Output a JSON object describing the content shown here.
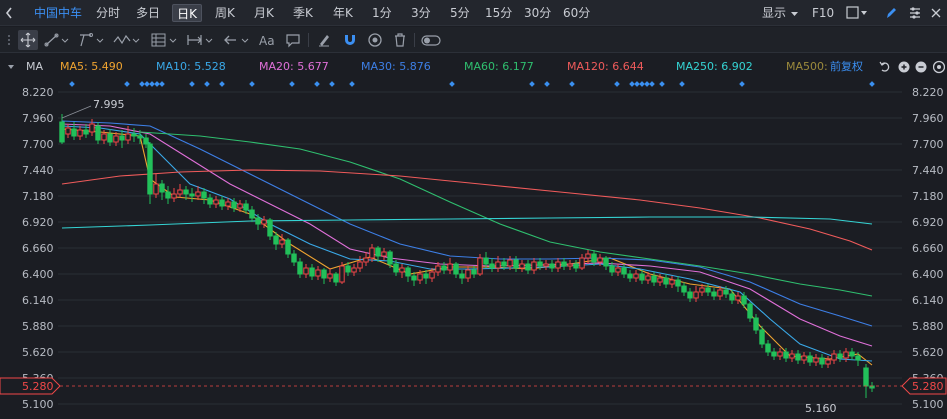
{
  "tabs": {
    "stock": "中国中车",
    "items": [
      "分时",
      "多日",
      "日K",
      "周K",
      "月K",
      "季K",
      "年K",
      "1分",
      "3分",
      "5分",
      "15分",
      "30分",
      "60分"
    ],
    "selected": "日K",
    "display_label": "显示",
    "f10_label": "F10"
  },
  "ma_bar": {
    "label": "MA",
    "items": [
      {
        "name": "MA5",
        "value": "5.490",
        "color": "#f0a430"
      },
      {
        "name": "MA10",
        "value": "5.528",
        "color": "#3aa9e8"
      },
      {
        "name": "MA20",
        "value": "5.677",
        "color": "#e070d9"
      },
      {
        "name": "MA30",
        "value": "5.876",
        "color": "#3d7fe6"
      },
      {
        "name": "MA60",
        "value": "6.177",
        "color": "#2fbf6f"
      },
      {
        "name": "MA120",
        "value": "6.644",
        "color": "#f05b5b"
      },
      {
        "name": "MA250",
        "value": "6.902",
        "color": "#35d4d4"
      },
      {
        "name": "MA500",
        "value": "",
        "color": "#9c8a3c"
      }
    ],
    "adjust_label": "前复权"
  },
  "colors": {
    "up": "#f04848",
    "down": "#22c05a",
    "grid": "#2a2e36",
    "axis_text": "#b8bcc4",
    "marker": "#3a8ff0",
    "price_tag": "#f04848"
  },
  "chart_data": {
    "type": "candlestick",
    "y_ticks": [
      "8.220",
      "7.960",
      "7.700",
      "7.440",
      "7.180",
      "6.920",
      "6.660",
      "6.400",
      "6.140",
      "5.880",
      "5.620",
      "5.360",
      "5.100"
    ],
    "ylim": [
      5.1,
      8.22
    ],
    "current_price": "5.280",
    "high_label": "7.995",
    "low_label": "5.160",
    "marker_positions": [
      72,
      127,
      142,
      147,
      152,
      157,
      162,
      192,
      207,
      222,
      252,
      292,
      317,
      332,
      352,
      452,
      532,
      547,
      572,
      617,
      632,
      637,
      642,
      647,
      652,
      662,
      682,
      742,
      872
    ],
    "ma_lines": {
      "MA5": [
        [
          62,
          7.85
        ],
        [
          100,
          7.82
        ],
        [
          140,
          7.78
        ],
        [
          150,
          7.35
        ],
        [
          175,
          7.17
        ],
        [
          210,
          7.14
        ],
        [
          250,
          7.0
        ],
        [
          290,
          6.7
        ],
        [
          330,
          6.45
        ],
        [
          370,
          6.57
        ],
        [
          410,
          6.4
        ],
        [
          450,
          6.47
        ],
        [
          490,
          6.47
        ],
        [
          530,
          6.45
        ],
        [
          570,
          6.5
        ],
        [
          610,
          6.56
        ],
        [
          650,
          6.4
        ],
        [
          690,
          6.3
        ],
        [
          730,
          6.25
        ],
        [
          760,
          5.88
        ],
        [
          790,
          5.58
        ],
        [
          830,
          5.55
        ],
        [
          858,
          5.6
        ],
        [
          872,
          5.49
        ]
      ],
      "MA10": [
        [
          62,
          7.88
        ],
        [
          100,
          7.86
        ],
        [
          140,
          7.8
        ],
        [
          160,
          7.6
        ],
        [
          190,
          7.3
        ],
        [
          230,
          7.15
        ],
        [
          270,
          6.9
        ],
        [
          310,
          6.7
        ],
        [
          350,
          6.55
        ],
        [
          390,
          6.53
        ],
        [
          430,
          6.45
        ],
        [
          470,
          6.45
        ],
        [
          510,
          6.46
        ],
        [
          550,
          6.47
        ],
        [
          600,
          6.5
        ],
        [
          640,
          6.45
        ],
        [
          690,
          6.35
        ],
        [
          740,
          6.22
        ],
        [
          770,
          5.95
        ],
        [
          800,
          5.7
        ],
        [
          840,
          5.55
        ],
        [
          872,
          5.53
        ]
      ],
      "MA20": [
        [
          62,
          7.9
        ],
        [
          110,
          7.88
        ],
        [
          150,
          7.8
        ],
        [
          190,
          7.55
        ],
        [
          230,
          7.3
        ],
        [
          270,
          7.1
        ],
        [
          310,
          6.9
        ],
        [
          350,
          6.65
        ],
        [
          390,
          6.56
        ],
        [
          440,
          6.5
        ],
        [
          490,
          6.48
        ],
        [
          540,
          6.49
        ],
        [
          600,
          6.51
        ],
        [
          650,
          6.48
        ],
        [
          700,
          6.42
        ],
        [
          750,
          6.25
        ],
        [
          800,
          5.95
        ],
        [
          840,
          5.78
        ],
        [
          872,
          5.68
        ]
      ],
      "MA30": [
        [
          62,
          7.93
        ],
        [
          110,
          7.91
        ],
        [
          150,
          7.88
        ],
        [
          200,
          7.65
        ],
        [
          250,
          7.4
        ],
        [
          300,
          7.15
        ],
        [
          350,
          6.9
        ],
        [
          400,
          6.7
        ],
        [
          450,
          6.58
        ],
        [
          500,
          6.55
        ],
        [
          550,
          6.55
        ],
        [
          600,
          6.56
        ],
        [
          650,
          6.54
        ],
        [
          700,
          6.47
        ],
        [
          750,
          6.32
        ],
        [
          800,
          6.1
        ],
        [
          840,
          5.98
        ],
        [
          872,
          5.88
        ]
      ],
      "MA60": [
        [
          140,
          7.82
        ],
        [
          200,
          7.78
        ],
        [
          250,
          7.72
        ],
        [
          300,
          7.65
        ],
        [
          350,
          7.52
        ],
        [
          400,
          7.35
        ],
        [
          450,
          7.12
        ],
        [
          500,
          6.9
        ],
        [
          550,
          6.72
        ],
        [
          600,
          6.62
        ],
        [
          650,
          6.55
        ],
        [
          700,
          6.48
        ],
        [
          750,
          6.4
        ],
        [
          800,
          6.3
        ],
        [
          840,
          6.24
        ],
        [
          872,
          6.18
        ]
      ],
      "MA120": [
        [
          62,
          7.3
        ],
        [
          120,
          7.38
        ],
        [
          180,
          7.42
        ],
        [
          250,
          7.44
        ],
        [
          320,
          7.43
        ],
        [
          400,
          7.38
        ],
        [
          480,
          7.3
        ],
        [
          560,
          7.22
        ],
        [
          640,
          7.14
        ],
        [
          700,
          7.06
        ],
        [
          760,
          6.96
        ],
        [
          810,
          6.85
        ],
        [
          850,
          6.73
        ],
        [
          872,
          6.64
        ]
      ],
      "MA250": [
        [
          62,
          6.86
        ],
        [
          150,
          6.89
        ],
        [
          250,
          6.93
        ],
        [
          350,
          6.94
        ],
        [
          450,
          6.95
        ],
        [
          550,
          6.96
        ],
        [
          650,
          6.97
        ],
        [
          750,
          6.97
        ],
        [
          830,
          6.95
        ],
        [
          872,
          6.9
        ]
      ]
    },
    "candles": [
      [
        62,
        7.92,
        7.72,
        8.0,
        7.7
      ],
      [
        68,
        7.8,
        7.86,
        7.9,
        7.76
      ],
      [
        74,
        7.85,
        7.78,
        7.92,
        7.74
      ],
      [
        80,
        7.78,
        7.84,
        7.88,
        7.74
      ],
      [
        86,
        7.84,
        7.8,
        7.9,
        7.76
      ],
      [
        92,
        7.82,
        7.9,
        7.95,
        7.78
      ],
      [
        98,
        7.88,
        7.74,
        7.92,
        7.7
      ],
      [
        104,
        7.74,
        7.8,
        7.84,
        7.7
      ],
      [
        110,
        7.8,
        7.72,
        7.85,
        7.68
      ],
      [
        116,
        7.72,
        7.78,
        7.82,
        7.68
      ],
      [
        122,
        7.78,
        7.74,
        7.84,
        7.66
      ],
      [
        128,
        7.74,
        7.8,
        7.88,
        7.7
      ],
      [
        134,
        7.8,
        7.78,
        7.86,
        7.72
      ],
      [
        140,
        7.78,
        7.76,
        7.84,
        7.7
      ],
      [
        146,
        7.76,
        7.7,
        7.8,
        7.66
      ],
      [
        150,
        7.7,
        7.2,
        7.72,
        7.1
      ],
      [
        156,
        7.2,
        7.3,
        7.4,
        7.16
      ],
      [
        162,
        7.3,
        7.22,
        7.34,
        7.14
      ],
      [
        168,
        7.22,
        7.16,
        7.28,
        7.1
      ],
      [
        174,
        7.16,
        7.2,
        7.26,
        7.12
      ],
      [
        180,
        7.2,
        7.24,
        7.3,
        7.16
      ],
      [
        186,
        7.24,
        7.2,
        7.28,
        7.14
      ],
      [
        192,
        7.2,
        7.18,
        7.26,
        7.12
      ],
      [
        198,
        7.18,
        7.22,
        7.28,
        7.14
      ],
      [
        204,
        7.22,
        7.16,
        7.26,
        7.1
      ],
      [
        210,
        7.16,
        7.1,
        7.2,
        7.06
      ],
      [
        216,
        7.1,
        7.14,
        7.18,
        7.06
      ],
      [
        222,
        7.14,
        7.08,
        7.18,
        7.04
      ],
      [
        228,
        7.08,
        7.12,
        7.16,
        7.04
      ],
      [
        234,
        7.12,
        7.06,
        7.16,
        7.02
      ],
      [
        240,
        7.06,
        7.1,
        7.14,
        7.02
      ],
      [
        246,
        7.1,
        7.04,
        7.14,
        7.0
      ],
      [
        252,
        7.04,
        6.96,
        7.08,
        6.92
      ],
      [
        258,
        6.96,
        6.9,
        7.0,
        6.84
      ],
      [
        264,
        6.9,
        6.94,
        6.98,
        6.86
      ],
      [
        270,
        6.94,
        6.78,
        6.96,
        6.74
      ],
      [
        276,
        6.78,
        6.7,
        6.82,
        6.64
      ],
      [
        282,
        6.7,
        6.74,
        6.8,
        6.66
      ],
      [
        288,
        6.74,
        6.6,
        6.76,
        6.56
      ],
      [
        294,
        6.6,
        6.52,
        6.64,
        6.48
      ],
      [
        300,
        6.52,
        6.4,
        6.56,
        6.36
      ],
      [
        306,
        6.4,
        6.46,
        6.5,
        6.36
      ],
      [
        312,
        6.46,
        6.38,
        6.5,
        6.34
      ],
      [
        318,
        6.38,
        6.44,
        6.48,
        6.34
      ],
      [
        324,
        6.44,
        6.36,
        6.46,
        6.3
      ],
      [
        330,
        6.36,
        6.4,
        6.46,
        6.32
      ],
      [
        336,
        6.4,
        6.32,
        6.42,
        6.28
      ],
      [
        342,
        6.32,
        6.48,
        6.52,
        6.3
      ],
      [
        348,
        6.48,
        6.42,
        6.52,
        6.38
      ],
      [
        354,
        6.42,
        6.46,
        6.5,
        6.38
      ],
      [
        360,
        6.46,
        6.52,
        6.58,
        6.42
      ],
      [
        366,
        6.52,
        6.56,
        6.62,
        6.48
      ],
      [
        372,
        6.56,
        6.66,
        6.7,
        6.52
      ],
      [
        378,
        6.66,
        6.58,
        6.68,
        6.52
      ],
      [
        384,
        6.58,
        6.62,
        6.66,
        6.54
      ],
      [
        390,
        6.62,
        6.5,
        6.64,
        6.46
      ],
      [
        396,
        6.5,
        6.42,
        6.54,
        6.38
      ],
      [
        402,
        6.42,
        6.46,
        6.5,
        6.36
      ],
      [
        408,
        6.46,
        6.38,
        6.48,
        6.32
      ],
      [
        414,
        6.38,
        6.34,
        6.42,
        6.28
      ],
      [
        420,
        6.34,
        6.4,
        6.44,
        6.3
      ],
      [
        426,
        6.4,
        6.36,
        6.44,
        6.3
      ],
      [
        432,
        6.36,
        6.42,
        6.46,
        6.32
      ],
      [
        438,
        6.42,
        6.48,
        6.52,
        6.38
      ],
      [
        444,
        6.48,
        6.44,
        6.52,
        6.4
      ],
      [
        450,
        6.44,
        6.5,
        6.56,
        6.4
      ],
      [
        456,
        6.5,
        6.4,
        6.52,
        6.36
      ],
      [
        462,
        6.4,
        6.36,
        6.44,
        6.3
      ],
      [
        468,
        6.36,
        6.44,
        6.48,
        6.32
      ],
      [
        474,
        6.44,
        6.4,
        6.48,
        6.36
      ],
      [
        480,
        6.4,
        6.56,
        6.6,
        6.38
      ],
      [
        486,
        6.56,
        6.5,
        6.62,
        6.46
      ],
      [
        492,
        6.5,
        6.46,
        6.56,
        6.42
      ],
      [
        498,
        6.46,
        6.52,
        6.58,
        6.42
      ],
      [
        504,
        6.52,
        6.48,
        6.56,
        6.44
      ],
      [
        510,
        6.48,
        6.54,
        6.58,
        6.44
      ],
      [
        516,
        6.54,
        6.46,
        6.58,
        6.42
      ],
      [
        522,
        6.46,
        6.5,
        6.54,
        6.42
      ],
      [
        528,
        6.5,
        6.44,
        6.54,
        6.4
      ],
      [
        534,
        6.44,
        6.52,
        6.56,
        6.4
      ],
      [
        540,
        6.52,
        6.48,
        6.56,
        6.44
      ],
      [
        546,
        6.48,
        6.5,
        6.54,
        6.44
      ],
      [
        552,
        6.5,
        6.46,
        6.54,
        6.42
      ],
      [
        558,
        6.46,
        6.52,
        6.56,
        6.42
      ],
      [
        564,
        6.52,
        6.48,
        6.56,
        6.44
      ],
      [
        570,
        6.48,
        6.5,
        6.54,
        6.44
      ],
      [
        576,
        6.5,
        6.46,
        6.54,
        6.42
      ],
      [
        582,
        6.46,
        6.56,
        6.6,
        6.44
      ],
      [
        588,
        6.56,
        6.6,
        6.64,
        6.5
      ],
      [
        594,
        6.6,
        6.52,
        6.64,
        6.48
      ],
      [
        600,
        6.52,
        6.56,
        6.6,
        6.48
      ],
      [
        606,
        6.56,
        6.48,
        6.58,
        6.44
      ],
      [
        612,
        6.48,
        6.42,
        6.52,
        6.38
      ],
      [
        618,
        6.42,
        6.46,
        6.5,
        6.38
      ],
      [
        624,
        6.46,
        6.4,
        6.5,
        6.36
      ],
      [
        630,
        6.4,
        6.36,
        6.44,
        6.32
      ],
      [
        636,
        6.36,
        6.4,
        6.44,
        6.32
      ],
      [
        642,
        6.4,
        6.34,
        6.44,
        6.3
      ],
      [
        648,
        6.34,
        6.38,
        6.42,
        6.3
      ],
      [
        654,
        6.38,
        6.32,
        6.42,
        6.28
      ],
      [
        660,
        6.32,
        6.36,
        6.4,
        6.28
      ],
      [
        666,
        6.36,
        6.3,
        6.4,
        6.26
      ],
      [
        672,
        6.3,
        6.34,
        6.38,
        6.26
      ],
      [
        678,
        6.34,
        6.28,
        6.38,
        6.22
      ],
      [
        684,
        6.28,
        6.22,
        6.32,
        6.18
      ],
      [
        690,
        6.22,
        6.16,
        6.26,
        6.12
      ],
      [
        696,
        6.16,
        6.22,
        6.28,
        6.12
      ],
      [
        702,
        6.22,
        6.26,
        6.3,
        6.18
      ],
      [
        708,
        6.26,
        6.22,
        6.3,
        6.18
      ],
      [
        714,
        6.22,
        6.18,
        6.26,
        6.14
      ],
      [
        720,
        6.18,
        6.24,
        6.28,
        6.14
      ],
      [
        726,
        6.24,
        6.2,
        6.28,
        6.16
      ],
      [
        732,
        6.2,
        6.14,
        6.24,
        6.1
      ],
      [
        738,
        6.14,
        6.18,
        6.22,
        6.1
      ],
      [
        744,
        6.18,
        6.1,
        6.22,
        6.06
      ],
      [
        750,
        6.1,
        5.96,
        6.12,
        5.92
      ],
      [
        756,
        5.96,
        5.84,
        6.0,
        5.8
      ],
      [
        762,
        5.84,
        5.7,
        5.88,
        5.66
      ],
      [
        768,
        5.7,
        5.62,
        5.74,
        5.58
      ],
      [
        774,
        5.62,
        5.58,
        5.66,
        5.54
      ],
      [
        780,
        5.58,
        5.62,
        5.66,
        5.54
      ],
      [
        786,
        5.62,
        5.56,
        5.66,
        5.52
      ],
      [
        792,
        5.56,
        5.6,
        5.64,
        5.52
      ],
      [
        798,
        5.6,
        5.54,
        5.64,
        5.5
      ],
      [
        804,
        5.54,
        5.58,
        5.62,
        5.5
      ],
      [
        810,
        5.58,
        5.52,
        5.62,
        5.48
      ],
      [
        816,
        5.52,
        5.56,
        5.6,
        5.48
      ],
      [
        822,
        5.56,
        5.5,
        5.6,
        5.46
      ],
      [
        828,
        5.5,
        5.54,
        5.58,
        5.46
      ],
      [
        834,
        5.54,
        5.6,
        5.64,
        5.5
      ],
      [
        840,
        5.6,
        5.56,
        5.64,
        5.52
      ],
      [
        846,
        5.56,
        5.62,
        5.66,
        5.52
      ],
      [
        852,
        5.62,
        5.58,
        5.66,
        5.54
      ],
      [
        858,
        5.58,
        5.54,
        5.62,
        5.48
      ],
      [
        866,
        5.46,
        5.28,
        5.5,
        5.16
      ],
      [
        872,
        5.28,
        5.26,
        5.32,
        5.22
      ]
    ]
  }
}
